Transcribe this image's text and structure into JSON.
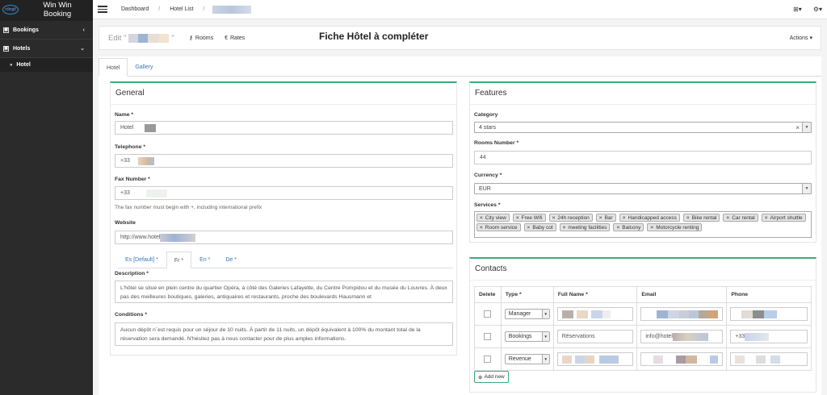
{
  "sidebar": {
    "brand_logo": "rdingif",
    "brand_title": "Win Win Booking",
    "items": [
      {
        "label": "Bookings",
        "icon": "grid-icon",
        "chevron": "‹"
      },
      {
        "label": "Hotels",
        "icon": "grid-icon",
        "chevron": "⌄"
      }
    ],
    "sub_item": "Hotel"
  },
  "topbar": {
    "crumbs": [
      "Dashboard",
      "Hotel List"
    ],
    "sep": "/",
    "plus": "⊞▾",
    "gear": "⚙▾"
  },
  "subheader": {
    "edit_prefix": "Edit \"",
    "edit_suffix": "\"",
    "rooms": "Rooms",
    "rates": "Rates",
    "actions": "Actions ▾"
  },
  "overlay_title": "Fiche Hôtel à compléter",
  "tabs": [
    "Hotel",
    "Gallery"
  ],
  "general": {
    "title": "General",
    "name_label": "Name *",
    "name_value": "Hotel",
    "phone_label": "Telephone *",
    "phone_value": "+33",
    "fax_label": "Fax Number *",
    "fax_value": "+33",
    "fax_help": "The fax number must begin with +, including international prefix",
    "website_label": "Website",
    "website_value": "http://www.hotel",
    "lang_tabs": [
      "Es [Default] *",
      "Fr *",
      "En *",
      "De *"
    ],
    "desc_label": "Description *",
    "desc_text": "L'hôtel            se situe en plein centre du quartier Opéra, à côté des Galeries Lafayette, du Centre Pompidou et du musée du Louvres. À deux pas des meilleures boutiques, galeries, antiquaires et restaurants, proche des boulevards Hausmann et",
    "cond_label": "Conditions *",
    "cond_text": "Aucun dépôt n´est requis pour un séjour de 10 nuits. À partir de 11 nuits, un dépôt équivalent à 100% du montant total de la réservation sera demandé. N'hésitez pas à nous contacter pour de plus amples informations."
  },
  "features": {
    "title": "Features",
    "category_label": "Category",
    "category_value": "4 stars",
    "rooms_label": "Rooms Number *",
    "rooms_value": "44",
    "currency_label": "Currency *",
    "currency_value": "EUR",
    "services_label": "Services *",
    "services": [
      "City view",
      "Free Wifi",
      "24h reception",
      "Bar",
      "Handicapped access",
      "Bike rental",
      "Car rental",
      "Airport shuttle",
      "Room service",
      "Baby cot",
      "meeting facilities",
      "Balcony",
      "Motorcycle renting"
    ]
  },
  "contacts": {
    "title": "Contacts",
    "headers": [
      "Delete",
      "Type *",
      "Full Name *",
      "Email",
      "Phone"
    ],
    "rows": [
      {
        "type": "Manager",
        "name": "",
        "email": "",
        "phone": ""
      },
      {
        "type": "Bookings",
        "name": "Réservations",
        "email": "info@hotel",
        "phone": "+33"
      },
      {
        "type": "Revenue",
        "name": "",
        "email": "",
        "phone": ""
      }
    ],
    "add_label": "Add new"
  }
}
